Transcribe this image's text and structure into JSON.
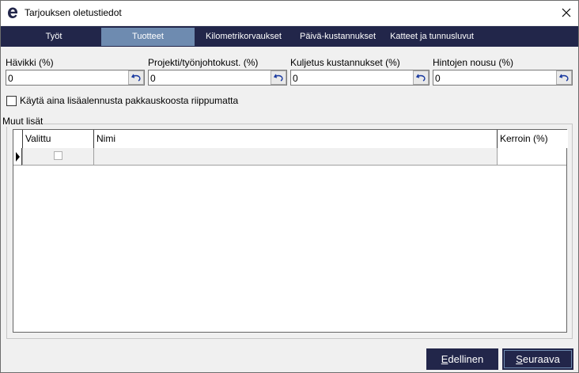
{
  "window": {
    "title": "Tarjouksen oletustiedot",
    "icon": "app-logo-icon",
    "close_icon": "close-icon"
  },
  "tabs": [
    {
      "label": "Työt",
      "active": false
    },
    {
      "label": "Tuotteet",
      "active": true
    },
    {
      "label": "Kilometrikorvaukset",
      "active": false
    },
    {
      "label": "Päivä-kustannukset",
      "active": false
    },
    {
      "label": "Katteet ja tunnusluvut",
      "active": false
    }
  ],
  "fields": [
    {
      "label": "Hävikki (%)",
      "value": "0"
    },
    {
      "label": "Projekti/työnjohtokust. (%)",
      "value": "0"
    },
    {
      "label": "Kuljetus kustannukset (%)",
      "value": "0"
    },
    {
      "label": "Hintojen nousu (%)",
      "value": "0"
    }
  ],
  "checkbox": {
    "label": "Käytä aina lisäalennusta pakkauskoosta riippumatta",
    "checked": false
  },
  "group": {
    "title": "Muut lisät",
    "columns": [
      "Valittu",
      "Nimi",
      "Kerroin (%)"
    ],
    "rows": [
      {
        "selected": false,
        "name": "",
        "factor": ""
      }
    ]
  },
  "buttons": {
    "previous_first": "E",
    "previous_rest": "dellinen",
    "next_first": "S",
    "next_rest": "euraava"
  },
  "colors": {
    "tabbar": "#22264a",
    "tab_active": "#6e8bb0",
    "button": "#22264a"
  }
}
